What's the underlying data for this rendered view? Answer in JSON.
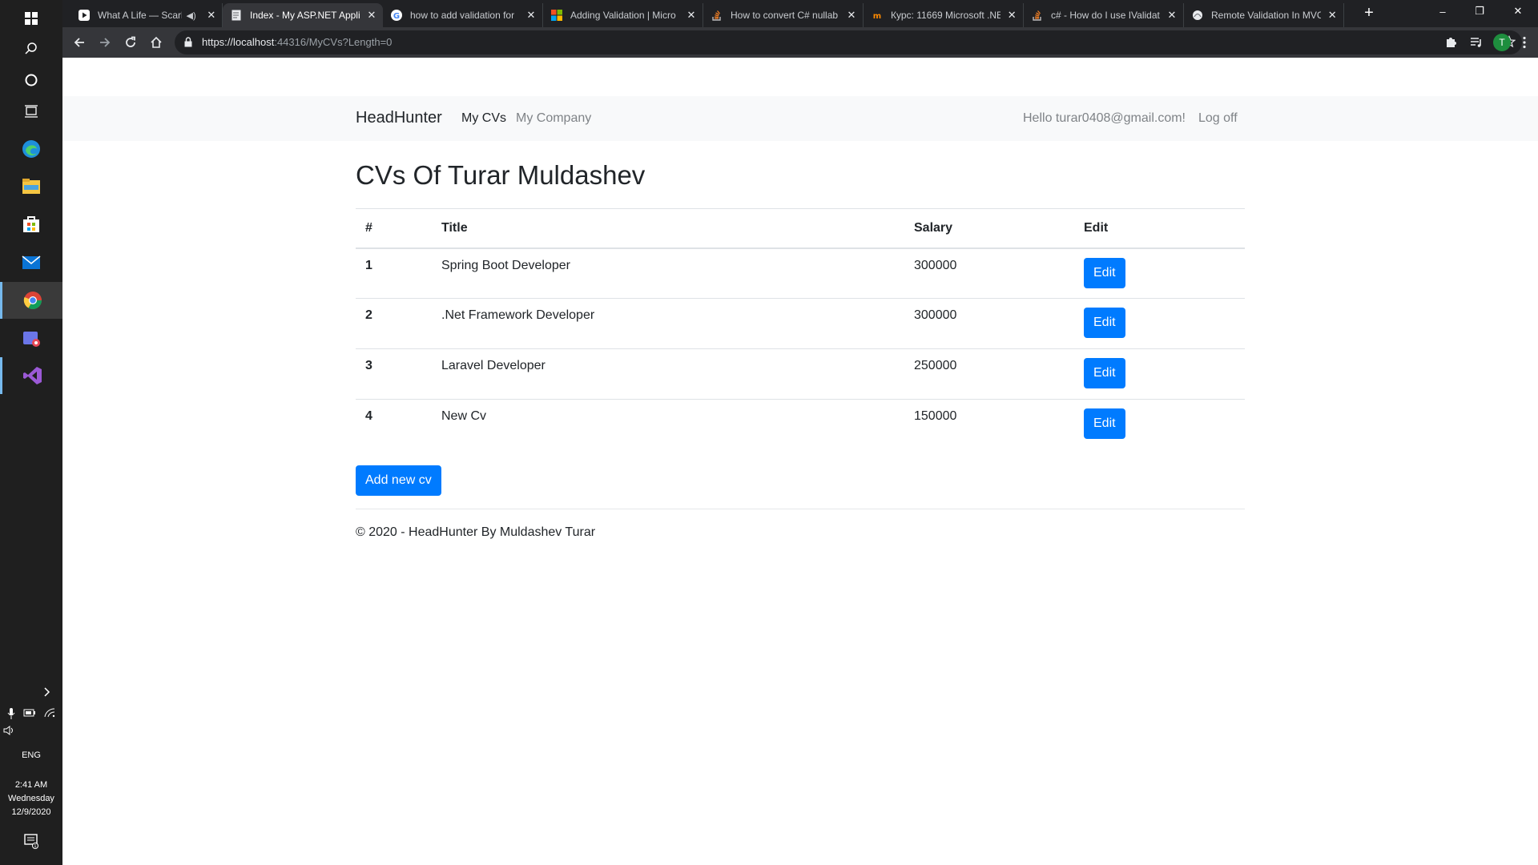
{
  "taskbar": {
    "time": "2:41 AM",
    "day": "Wednesday",
    "date": "12/9/2020",
    "language": "ENG"
  },
  "browser": {
    "tabs": [
      {
        "label": "What A Life — Scarlet",
        "icon": "play-icon",
        "audio": true
      },
      {
        "label": "Index - My ASP.NET Appli",
        "icon": "page-icon",
        "active": true
      },
      {
        "label": "how to add validation for",
        "icon": "google-icon"
      },
      {
        "label": "Adding Validation | Micro",
        "icon": "microsoft-icon"
      },
      {
        "label": "How to convert C# nullab",
        "icon": "stackoverflow-icon"
      },
      {
        "label": "Курс: 11669 Microsoft .NE",
        "icon": "itvdn-icon"
      },
      {
        "label": "c# - How do I use IValidat",
        "icon": "stackoverflow-icon"
      },
      {
        "label": "Remote Validation In MVC",
        "icon": "site-icon"
      }
    ],
    "url_prefix": "https://localhost",
    "url_rest": ":44316/MyCVs?Length=0",
    "profile_initial": "T"
  },
  "site": {
    "brand": "HeadHunter",
    "nav": {
      "my_cvs": "My CVs",
      "my_company": "My Company"
    },
    "user_greeting": "Hello turar0408@gmail.com!",
    "logoff": "Log off"
  },
  "main": {
    "heading": "CVs Of Turar Muldashev",
    "table_headers": {
      "num": "#",
      "title": "Title",
      "salary": "Salary",
      "edit": "Edit"
    },
    "rows": [
      {
        "num": "1",
        "title": "Spring Boot Developer",
        "salary": "300000",
        "edit": "Edit"
      },
      {
        "num": "2",
        "title": ".Net Framework Developer",
        "salary": "300000",
        "edit": "Edit"
      },
      {
        "num": "3",
        "title": "Laravel Developer",
        "salary": "250000",
        "edit": "Edit"
      },
      {
        "num": "4",
        "title": "New Cv",
        "salary": "150000",
        "edit": "Edit"
      }
    ],
    "add_button": "Add new cv",
    "footer": "© 2020 - HeadHunter By Muldashev Turar"
  },
  "colors": {
    "primary": "#007bff",
    "navbar_bg": "#f8f9fa",
    "browser_dark": "#202124",
    "taskbar": "#1f1f1f"
  }
}
